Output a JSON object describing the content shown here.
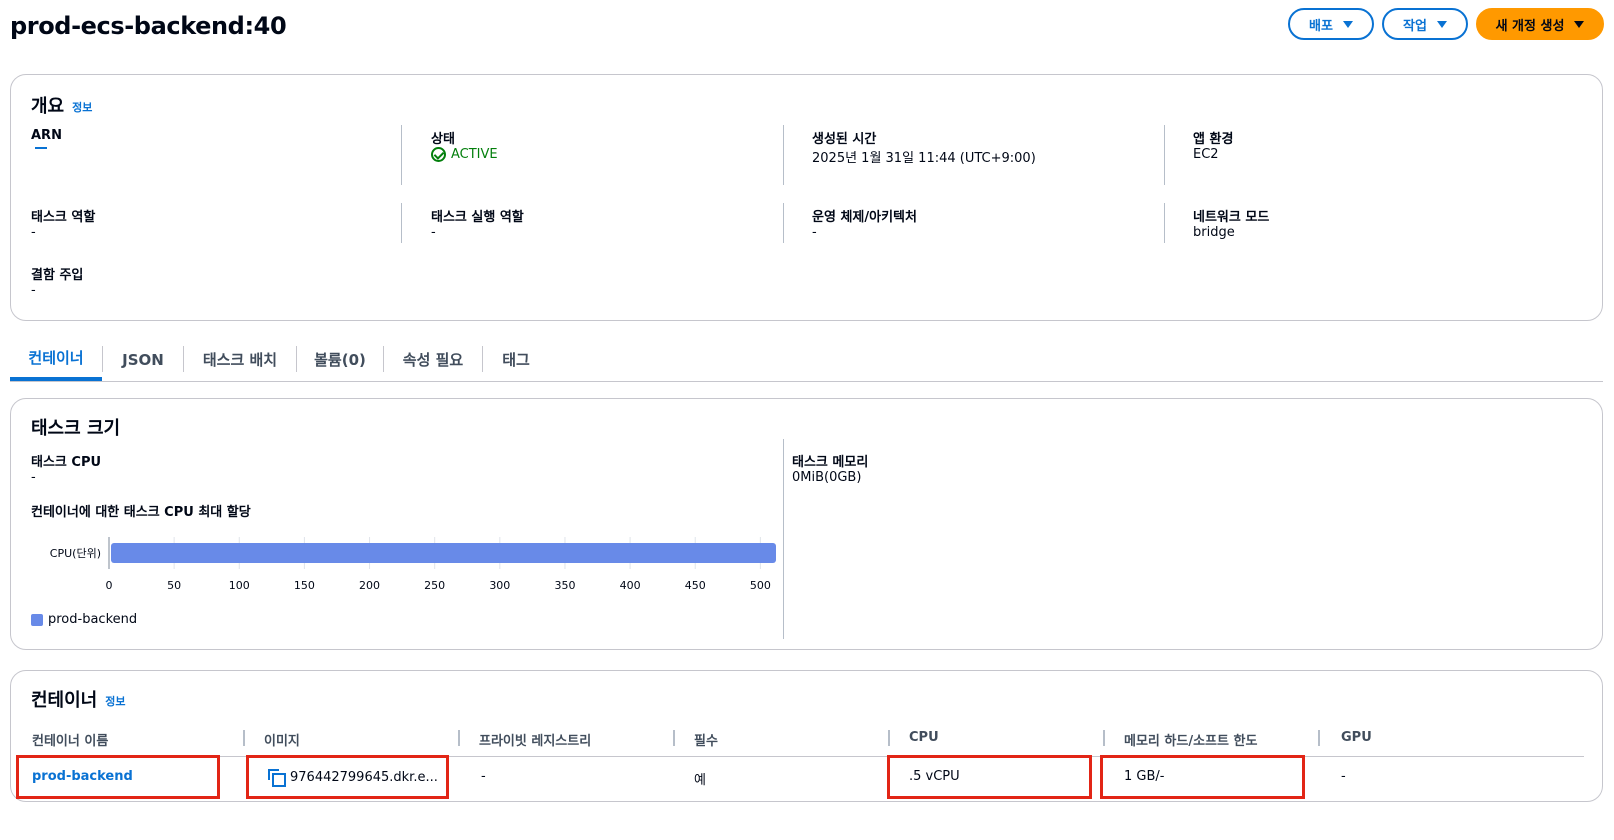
{
  "page": {
    "title": "prod-ecs-backend:40"
  },
  "actions": {
    "deploy": "배포",
    "actions": "작업",
    "create_revision": "새 개정 생성"
  },
  "overview": {
    "title": "개요",
    "info": "정보",
    "fields": {
      "arn": {
        "label": "ARN",
        "value": ""
      },
      "status": {
        "label": "상태",
        "value": "ACTIVE"
      },
      "created": {
        "label": "생성된 시간",
        "value": "2025년 1월 31일 11:44 (UTC+9:00)"
      },
      "app_env": {
        "label": "앱 환경",
        "value": "EC2"
      },
      "task_role": {
        "label": "태스크 역할",
        "value": "-"
      },
      "exec_role": {
        "label": "태스크 실행 역할",
        "value": "-"
      },
      "os_arch": {
        "label": "운영 체제/아키텍처",
        "value": "-"
      },
      "network_mode": {
        "label": "네트워크 모드",
        "value": "bridge"
      },
      "fault_injection": {
        "label": "결함 주입",
        "value": "-"
      }
    }
  },
  "tabs": [
    "컨테이너",
    "JSON",
    "태스크 배치",
    "볼륨(0)",
    "속성 필요",
    "태그"
  ],
  "task_size": {
    "title": "태스크 크기",
    "cpu_label": "태스크 CPU",
    "cpu_value": "-",
    "memory_label": "태스크 메모리",
    "memory_value": "0MiB(0GB)",
    "alloc_title": "컨테이너에 대한 태스크 CPU 최대 할당"
  },
  "chart_data": {
    "type": "bar",
    "orientation": "horizontal",
    "categories": [
      "CPU(단위)"
    ],
    "series": [
      {
        "name": "prod-backend",
        "values": [
          512
        ],
        "color": "#688ae8"
      }
    ],
    "xlim": [
      0,
      512
    ],
    "xticks": [
      0,
      50,
      100,
      150,
      200,
      250,
      300,
      350,
      400,
      450,
      500
    ],
    "grid": true,
    "legend": "bottom-left"
  },
  "containers": {
    "title": "컨테이너",
    "info": "정보",
    "columns": [
      "컨테이너 이름",
      "이미지",
      "프라이빗 레지스트리",
      "필수",
      "CPU",
      "메모리 하드/소프트 한도",
      "GPU"
    ],
    "rows": [
      {
        "name": "prod-backend",
        "image": "976442799645.dkr.e...",
        "registry": "-",
        "essential": "예",
        "cpu": ".5 vCPU",
        "memory": "1 GB/-",
        "gpu": "-"
      }
    ]
  }
}
